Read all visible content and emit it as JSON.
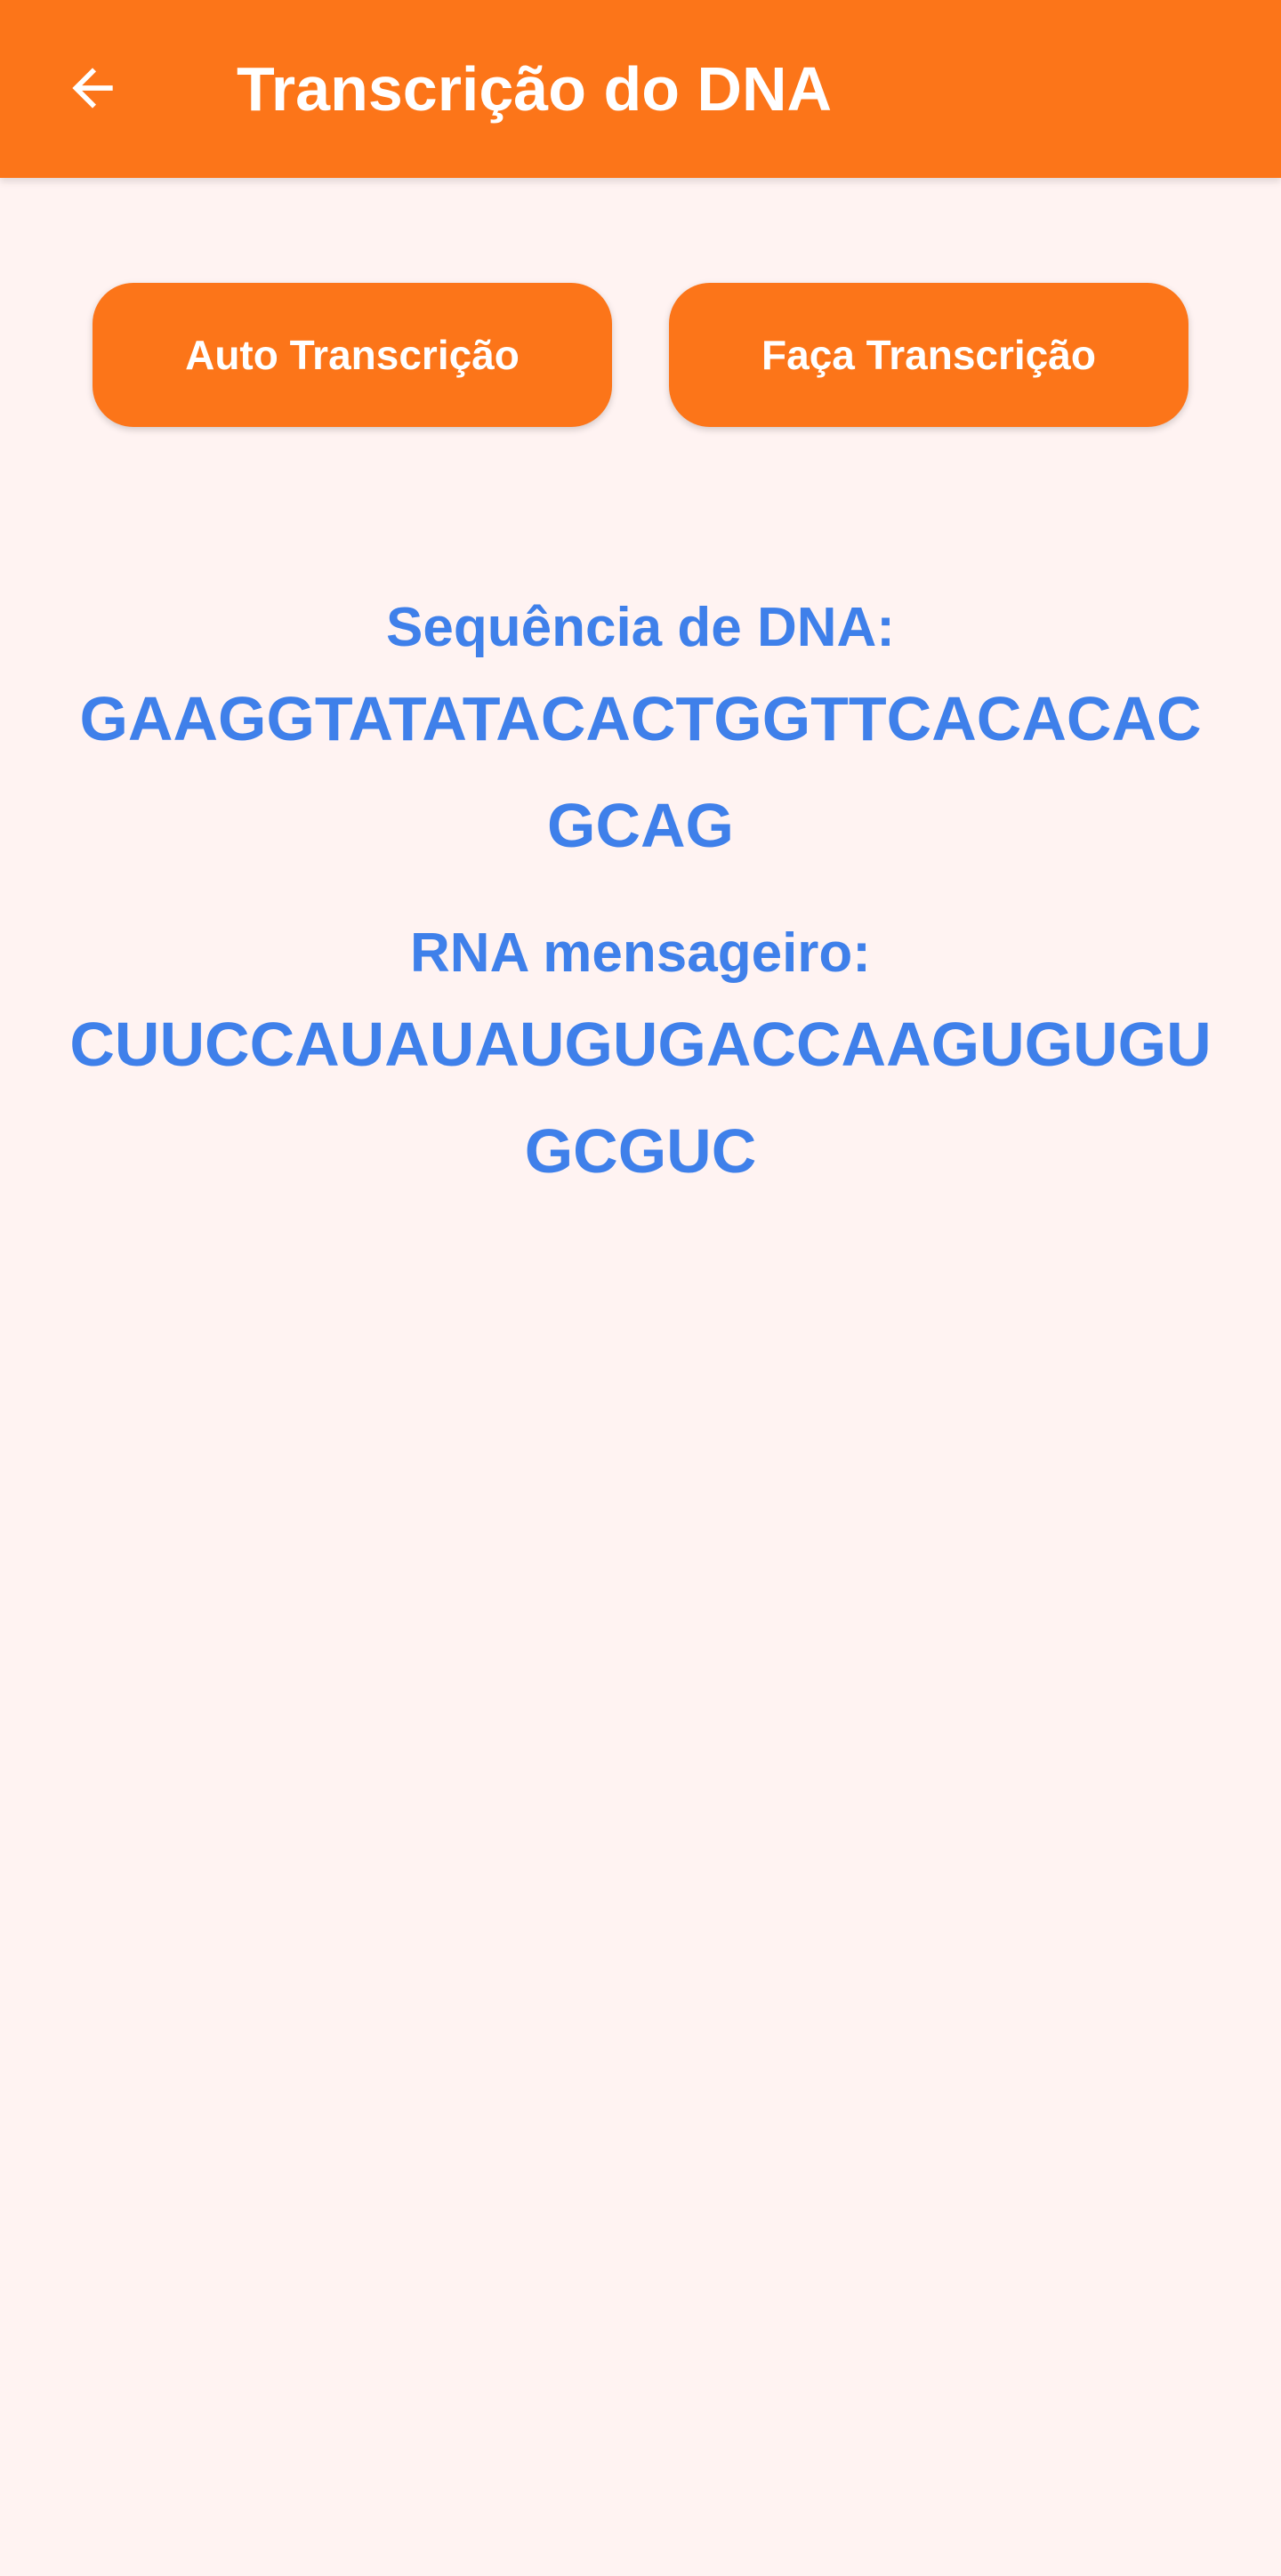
{
  "app_bar": {
    "title": "Transcrição do DNA",
    "back_icon": "arrow-left-icon",
    "background_color": "#FC7519",
    "title_color": "#FFFFFF"
  },
  "actions": {
    "auto_transcription_label": "Auto Transcrição",
    "manual_transcription_label": "Faça Transcrição",
    "button_color": "#FC7519",
    "text_color": "#FFFFFF"
  },
  "content": {
    "dna_label": "Sequência de DNA:",
    "dna_sequence": "GAAGGTATATACACTGGTTCACACACGCAG",
    "rna_label": "RNA mensageiro:",
    "rna_sequence": "CUUCCAUAUAUGUGACCAAGUGUGUGCGUC",
    "text_color": "#3F80EA"
  },
  "page": {
    "background_color": "#FFF3F2"
  }
}
